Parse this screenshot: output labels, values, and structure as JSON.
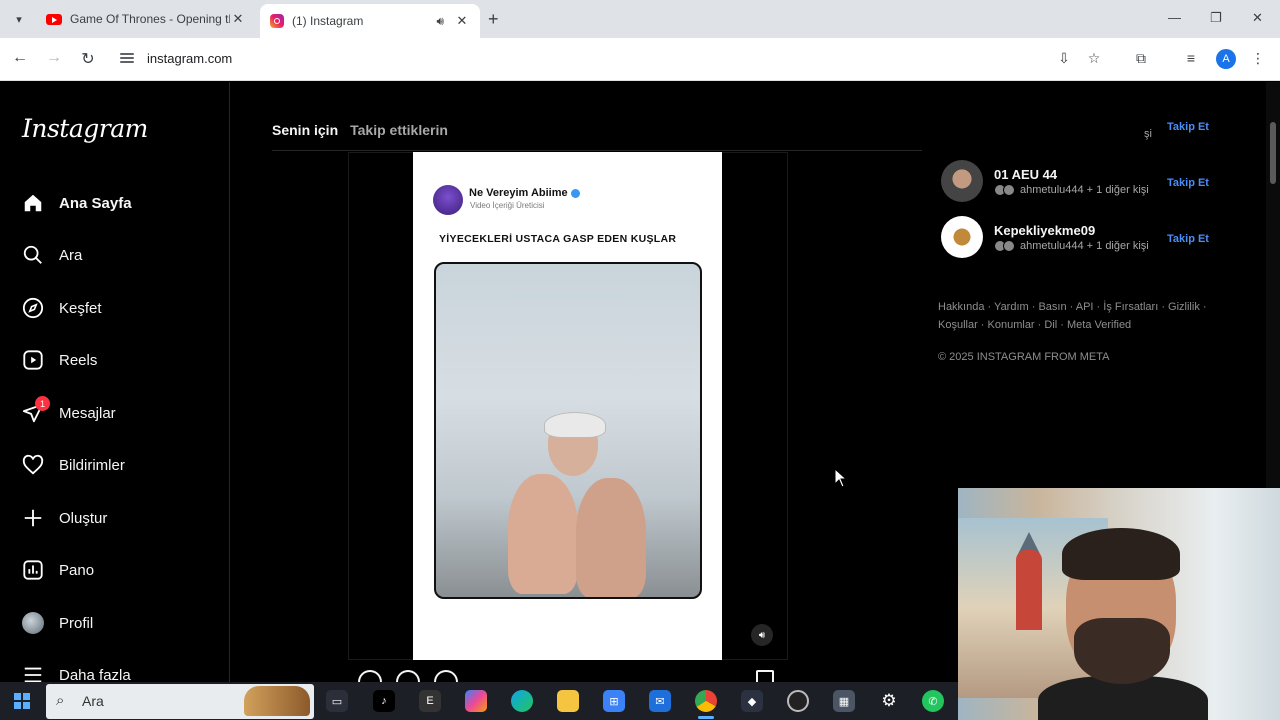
{
  "browser": {
    "tabs": [
      {
        "title": "Game Of Thrones - Opening th",
        "favicon": "youtube-favicon",
        "active": false
      },
      {
        "title": "(1) Instagram",
        "favicon": "instagram-favicon",
        "active": true
      }
    ],
    "url": "instagram.com",
    "profile_initial": "A"
  },
  "instagram": {
    "logo": "Instagram",
    "nav": [
      {
        "label": "Ana Sayfa",
        "icon": "home-icon",
        "active": true
      },
      {
        "label": "Ara",
        "icon": "search-icon"
      },
      {
        "label": "Keşfet",
        "icon": "compass-icon"
      },
      {
        "label": "Reels",
        "icon": "reels-icon"
      },
      {
        "label": "Mesajlar",
        "icon": "messages-icon",
        "badge": "1"
      },
      {
        "label": "Bildirimler",
        "icon": "heart-icon"
      },
      {
        "label": "Oluştur",
        "icon": "plus-icon"
      },
      {
        "label": "Pano",
        "icon": "dashboard-icon"
      },
      {
        "label": "Profil",
        "icon": "profile-avatar"
      },
      {
        "label": "Daha fazla",
        "icon": "menu-icon"
      }
    ],
    "feed_tabs": [
      "Senin için",
      "Takip ettiklerin"
    ],
    "post": {
      "account_name": "Ne Vereyim Abiime",
      "account_sub": "Video İçeriği Üreticisi",
      "title": "YİYECEKLERİ USTACA GASP EDEN KUŞLAR"
    },
    "suggestions": {
      "top_partial": "şi",
      "follow_label": "Takip Et",
      "items": [
        {
          "name": "01 AEU 44",
          "meta": "ahmetulu444 + 1 diğer kişi"
        },
        {
          "name": "Kepekliyekme09",
          "meta": "ahmetulu444 + 1 diğer kişi"
        }
      ]
    },
    "footer_links": "Hakkında · Yardım · Basın · API · İş Fırsatları · Gizlilik · Koşullar · Konumlar · Dil · Meta Verified",
    "copyright": "© 2025 INSTAGRAM FROM META"
  },
  "taskbar": {
    "search_label": "Ara",
    "apps": [
      "task-view-icon",
      "tiktok-icon",
      "epic-games-icon",
      "copilot-icon",
      "edge-icon",
      "file-explorer-icon",
      "store-icon",
      "outlook-icon",
      "chrome-icon",
      "davinci-icon",
      "speedtest-icon",
      "calculator-icon",
      "settings-icon",
      "whatsapp-icon"
    ]
  },
  "colors": {
    "accent_link": "#4a8df8",
    "badge": "#ff3040",
    "page_bg": "#000000"
  }
}
